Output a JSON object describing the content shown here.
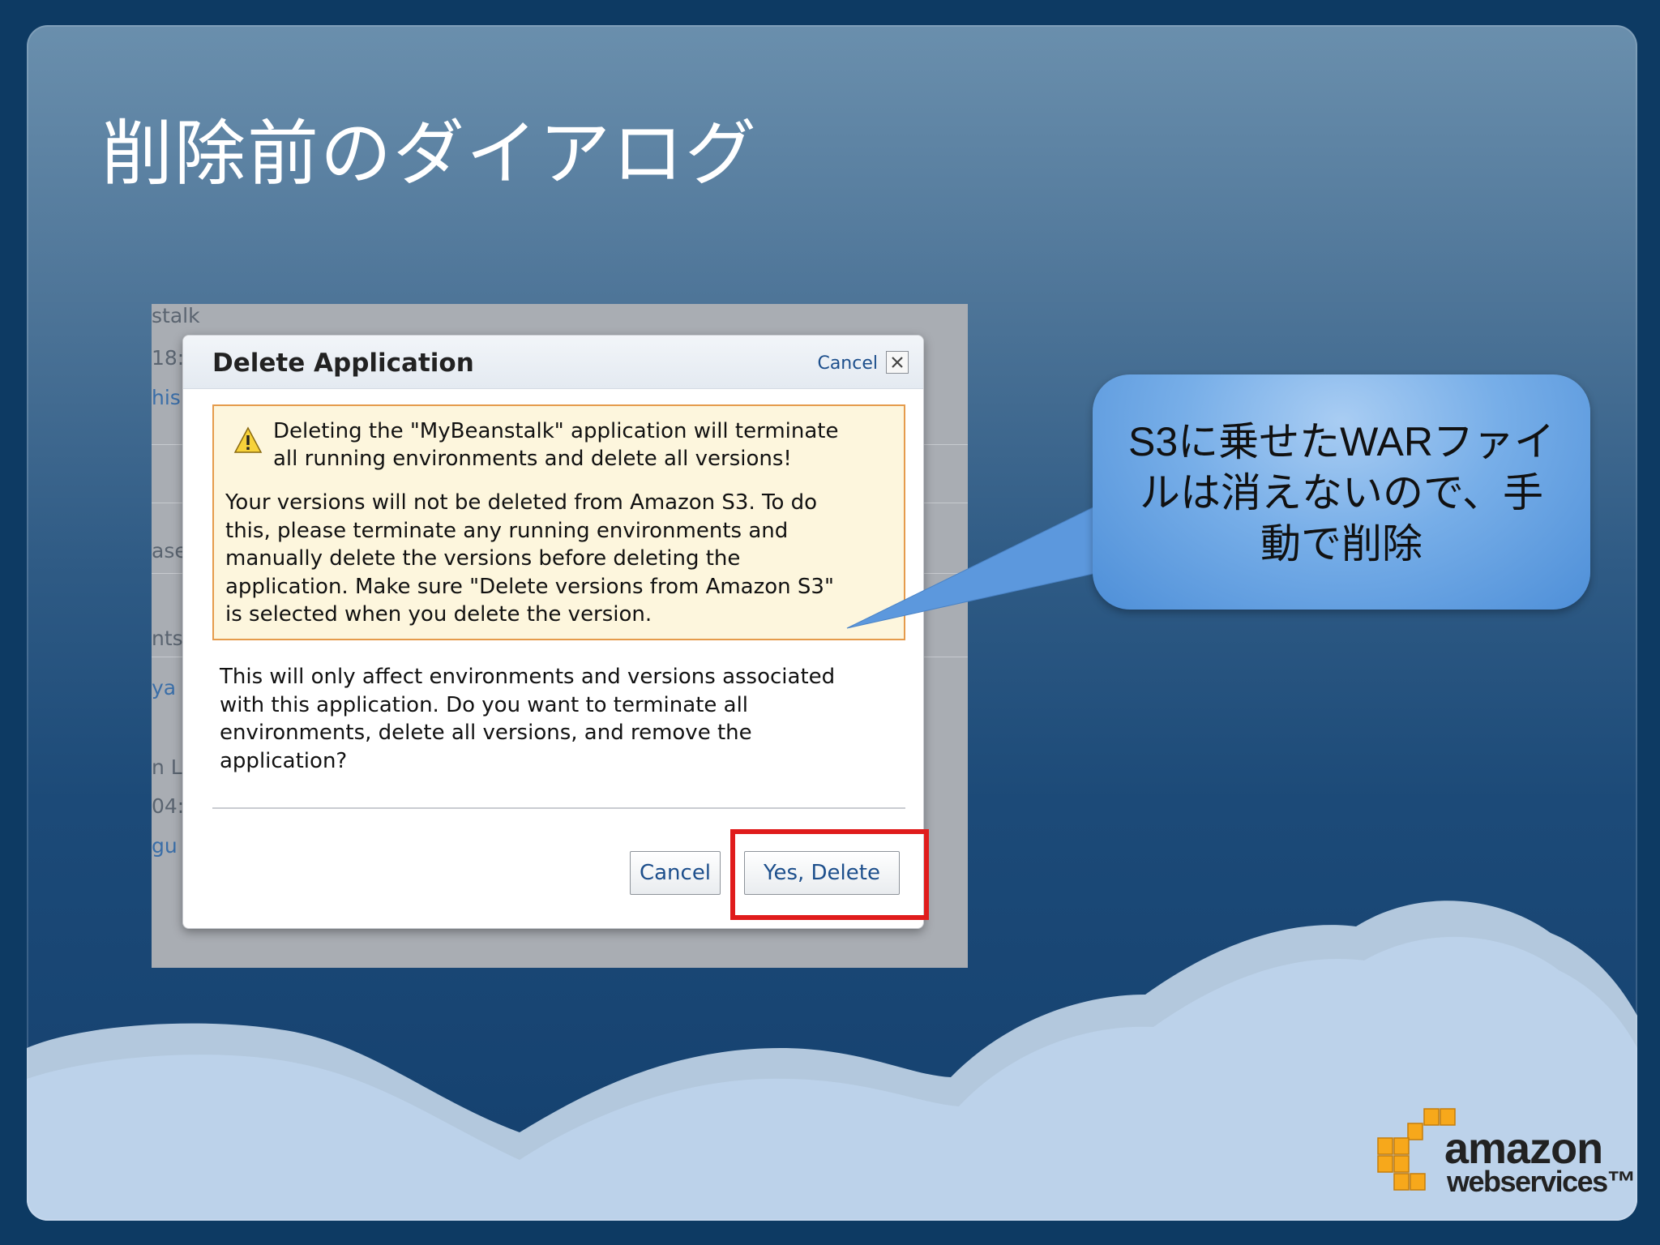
{
  "slide": {
    "title": "削除前のダイアログ"
  },
  "background_fragments": [
    "stalk",
    "18:",
    "his",
    "ase",
    "nts",
    "ya",
    "n L",
    "04:",
    "gu"
  ],
  "dialog": {
    "title": "Delete Application",
    "header_cancel": "Cancel",
    "close_icon": "close-icon",
    "warning": {
      "icon": "warning-icon",
      "heading_lines": [
        "Deleting the \"MyBeanstalk\" application will terminate",
        "all running environments and delete all versions!"
      ],
      "body_lines": [
        "Your versions will not be deleted from Amazon S3. To do",
        "this, please terminate any running environments and",
        "manually delete the versions before deleting the",
        "application. Make sure \"Delete versions from Amazon S3\"",
        "is selected when you delete the version."
      ]
    },
    "question_lines": [
      "This will only affect environments and versions associated",
      "with this application. Do you want to terminate all",
      "environments, delete all versions, and remove the",
      "application?"
    ],
    "buttons": {
      "cancel": "Cancel",
      "confirm": "Yes, Delete"
    }
  },
  "callout": {
    "lines": [
      "S3に乗せたWARファイ",
      "ルは消えないので、手",
      "動で削除"
    ]
  },
  "logo": {
    "line1": "amazon",
    "line2": "webservices™",
    "colors": {
      "cubes": "#f7a81b",
      "text": "#222222"
    }
  },
  "colors": {
    "highlight": "#e01c1c",
    "warning_border": "#e59b4c",
    "warning_bg": "#fdf6dd",
    "link": "#1d4f8c"
  }
}
